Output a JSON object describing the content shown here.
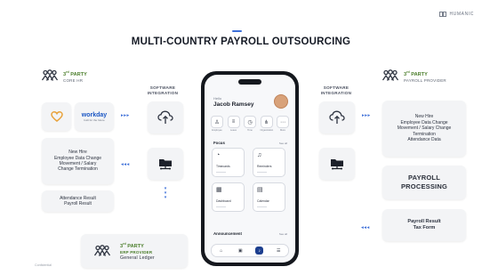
{
  "brand": {
    "name": "HUMANIC"
  },
  "title": "MULTI-COUNTRY PAYROLL OUTSOURCING",
  "left_party": {
    "title": "3rd PARTY",
    "subtitle": "CORE HR"
  },
  "right_party": {
    "title": "3rd PARTY",
    "subtitle": "PAYROLL PROVIDER"
  },
  "erp_party": {
    "title": "3rd PARTY",
    "subtitle": "ERP PROVIDER",
    "detail": "General Ledger"
  },
  "left_integration_label": "SOFTWARE INTEGRATION",
  "right_integration_label": "SOFTWARE INTEGRATION",
  "workday": {
    "name": "workday",
    "tagline": "built for the future"
  },
  "left_change_lines": [
    "New Hire",
    "Employee Data Change",
    "Movement / Salary",
    "Change Termination"
  ],
  "left_result_lines": [
    "Attendance Result",
    "Payroll Result"
  ],
  "right_change_lines": [
    "New Hire",
    "Employee Data Change",
    "Movement / Salary Change",
    "Termination",
    "Attendance Data"
  ],
  "payroll_processing_lines": [
    "PAYROLL",
    "PROCESSING"
  ],
  "payroll_result_lines": [
    "Payroll Result",
    "Tax Form"
  ],
  "arrows": {
    "right": "▸▸▸",
    "left": "◂◂◂"
  },
  "confidential": "Confidential",
  "phone": {
    "greeting": "Hello",
    "user": "Jacob Ramsey",
    "quick_actions": [
      "Employee",
      "Leave",
      "Time",
      "Organization",
      "More"
    ],
    "focus_title": "Focus",
    "see_all": "See all",
    "cards": [
      "Timecards",
      "Reminders",
      "Dashboard",
      "Calendar"
    ],
    "announcement_title": "Announcement"
  },
  "colors": {
    "accent": "#3d6fd8",
    "party_green": "#4a7d2a",
    "card_bg": "#f3f4f6",
    "phone_body": "#15181e"
  }
}
